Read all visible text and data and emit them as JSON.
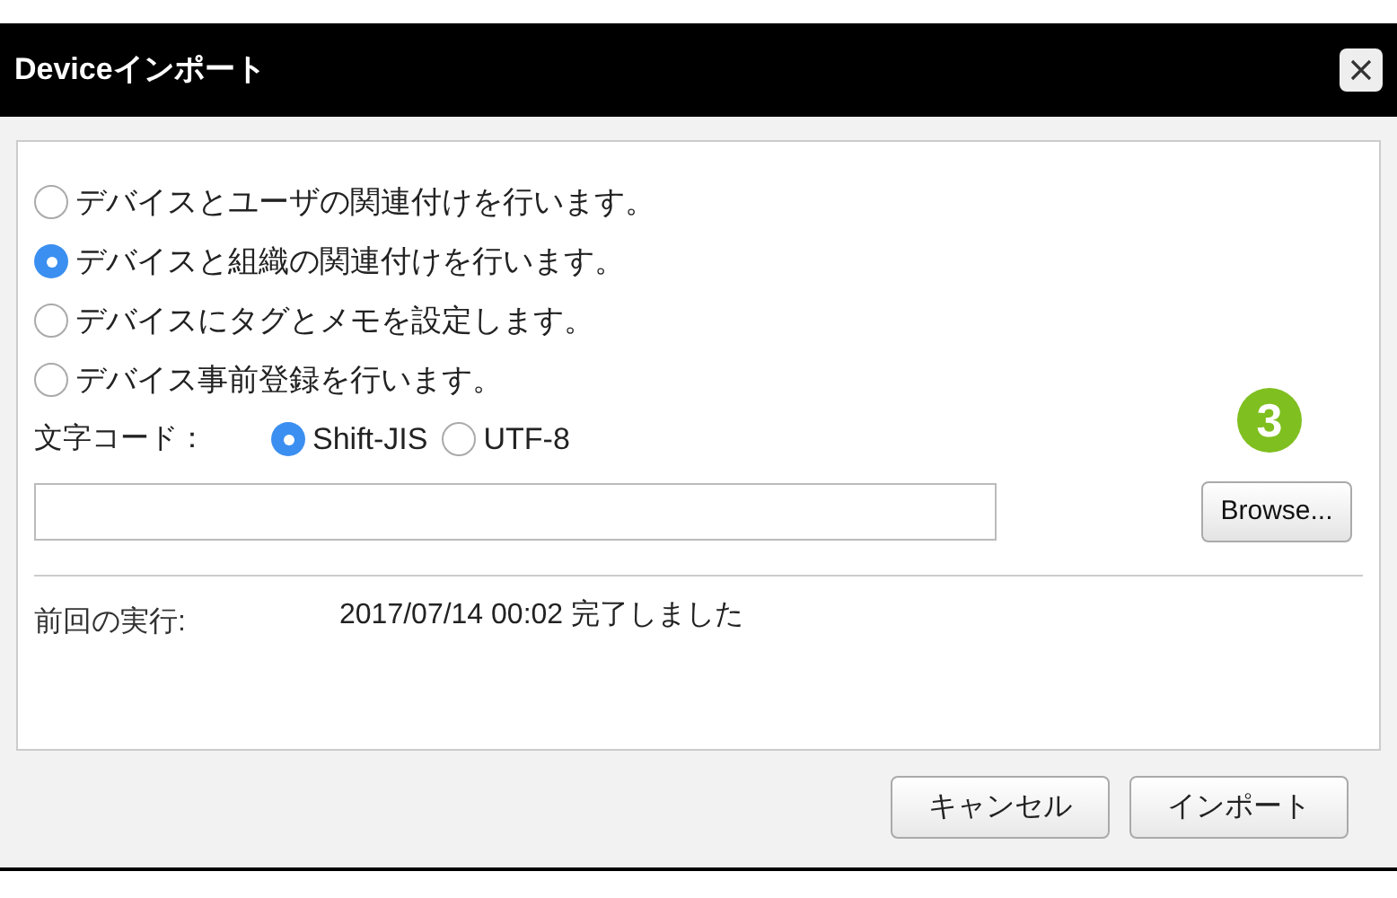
{
  "window": {
    "title": "Deviceインポート"
  },
  "options": [
    {
      "label": "デバイスとユーザの関連付けを行います。",
      "selected": false
    },
    {
      "label": "デバイスと組織の関連付けを行います。",
      "selected": true
    },
    {
      "label": "デバイスにタグとメモを設定します。",
      "selected": false
    },
    {
      "label": "デバイス事前登録を行います。",
      "selected": false
    }
  ],
  "encoding": {
    "label": "文字コード：",
    "choices": [
      {
        "label": "Shift-JIS",
        "selected": true
      },
      {
        "label": "UTF-8",
        "selected": false
      }
    ]
  },
  "browse_button": "Browse...",
  "step_marker": "3",
  "last_run": {
    "label": "前回の実行:",
    "value": "2017/07/14 00:02 完了しました"
  },
  "buttons": [
    "キャンセル",
    "インポート"
  ]
}
